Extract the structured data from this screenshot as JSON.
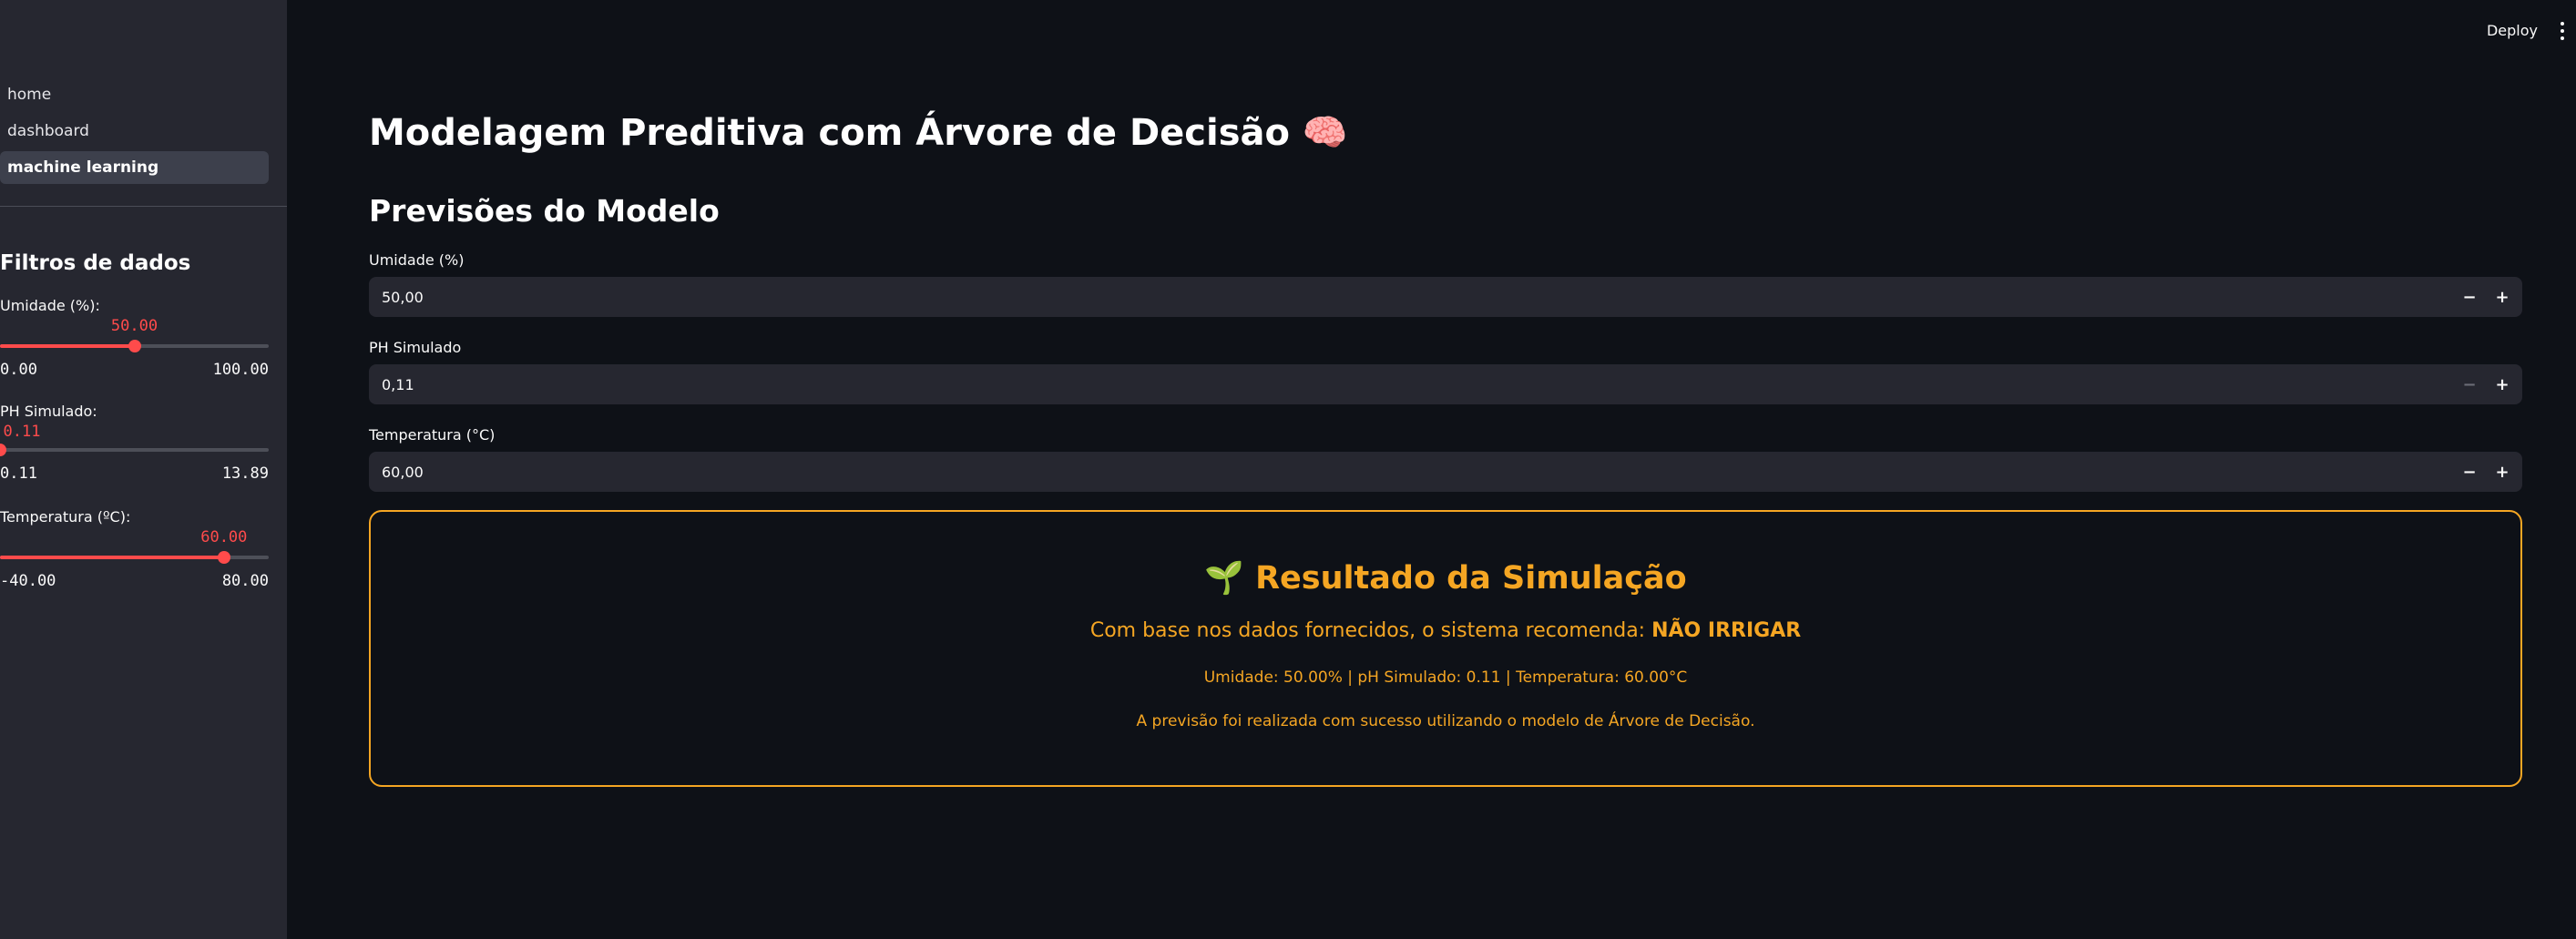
{
  "sidebar": {
    "nav": [
      {
        "label": "home",
        "active": false
      },
      {
        "label": "dashboard",
        "active": false
      },
      {
        "label": "machine learning",
        "active": true
      }
    ],
    "filters_title": "Filtros de dados",
    "sliders": [
      {
        "label": "Umidade (%):",
        "value": "50.00",
        "min": "0.00",
        "max": "100.00",
        "fraction": 0.5
      },
      {
        "label": "PH Simulado:",
        "value": "0.11",
        "min": "0.11",
        "max": "13.89",
        "fraction": 0.0
      },
      {
        "label": "Temperatura (ºC):",
        "value": "60.00",
        "min": "-40.00",
        "max": "80.00",
        "fraction": 0.8333
      }
    ]
  },
  "topbar": {
    "deploy_label": "Deploy",
    "menu_icon": "more-vertical-icon"
  },
  "main": {
    "title": "Modelagem Preditiva com Árvore de Decisão 🧠",
    "subtitle": "Previsões do Modelo",
    "fields": [
      {
        "label": "Umidade (%)",
        "value": "50,00",
        "minus_disabled": false
      },
      {
        "label": "PH Simulado",
        "value": "0,11",
        "minus_disabled": true
      },
      {
        "label": "Temperatura (°C)",
        "value": "60,00",
        "minus_disabled": false
      }
    ],
    "stepper": {
      "minus": "−",
      "plus": "+"
    }
  },
  "result": {
    "title": "🌱 Resultado da Simulação",
    "recommend_prefix": "Com base nos dados fornecidos, o sistema recomenda: ",
    "recommendation": "NÃO IRRIGAR",
    "metrics": "Umidade: 50.00% | pH Simulado: 0.11 | Temperatura: 60.00°C",
    "note": "A previsão foi realizada com sucesso utilizando o modelo de Árvore de Decisão."
  },
  "colors": {
    "accent": "#ff4b4b",
    "result": "#f5a623",
    "background": "#0e1117",
    "sidebar": "#262730"
  }
}
